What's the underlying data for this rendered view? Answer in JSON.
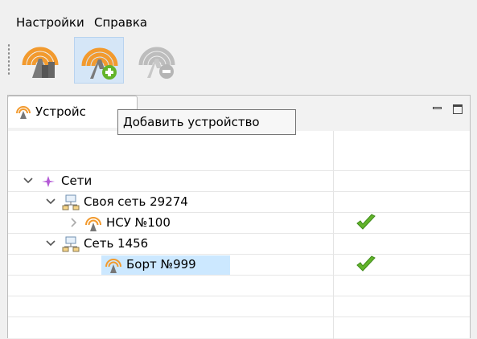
{
  "menu": {
    "items": [
      "Настройки",
      "Справка"
    ]
  },
  "toolbar": {
    "buttons": [
      {
        "name": "devices-button",
        "icon": "radar-servers-icon",
        "state": "normal"
      },
      {
        "name": "add-device-button",
        "icon": "radar-add-icon",
        "state": "hover"
      },
      {
        "name": "remove-device-button",
        "icon": "radar-remove-icon",
        "state": "disabled"
      }
    ]
  },
  "view": {
    "tab_label": "Устройс"
  },
  "tooltip": {
    "text": "Добавить устройство"
  },
  "tree": {
    "nodes": [
      {
        "label": "Сети",
        "level": 0,
        "expanded": true,
        "icon": "networks-star-icon"
      },
      {
        "label": "Своя сеть 29274",
        "level": 1,
        "expanded": true,
        "icon": "network-icon"
      },
      {
        "label": "НСУ №100",
        "level": 2,
        "expanded": false,
        "icon": "radar-device-icon",
        "status": "ok"
      },
      {
        "label": "Сеть 1456",
        "level": 1,
        "expanded": true,
        "icon": "network-icon"
      },
      {
        "label": "Борт №999",
        "level": 2,
        "icon": "radar-device-icon",
        "status": "ok",
        "selected": true
      }
    ]
  },
  "colors": {
    "accent_orange": "#f29a2e",
    "check_green": "#62b42a",
    "selection": "#cce8ff"
  }
}
